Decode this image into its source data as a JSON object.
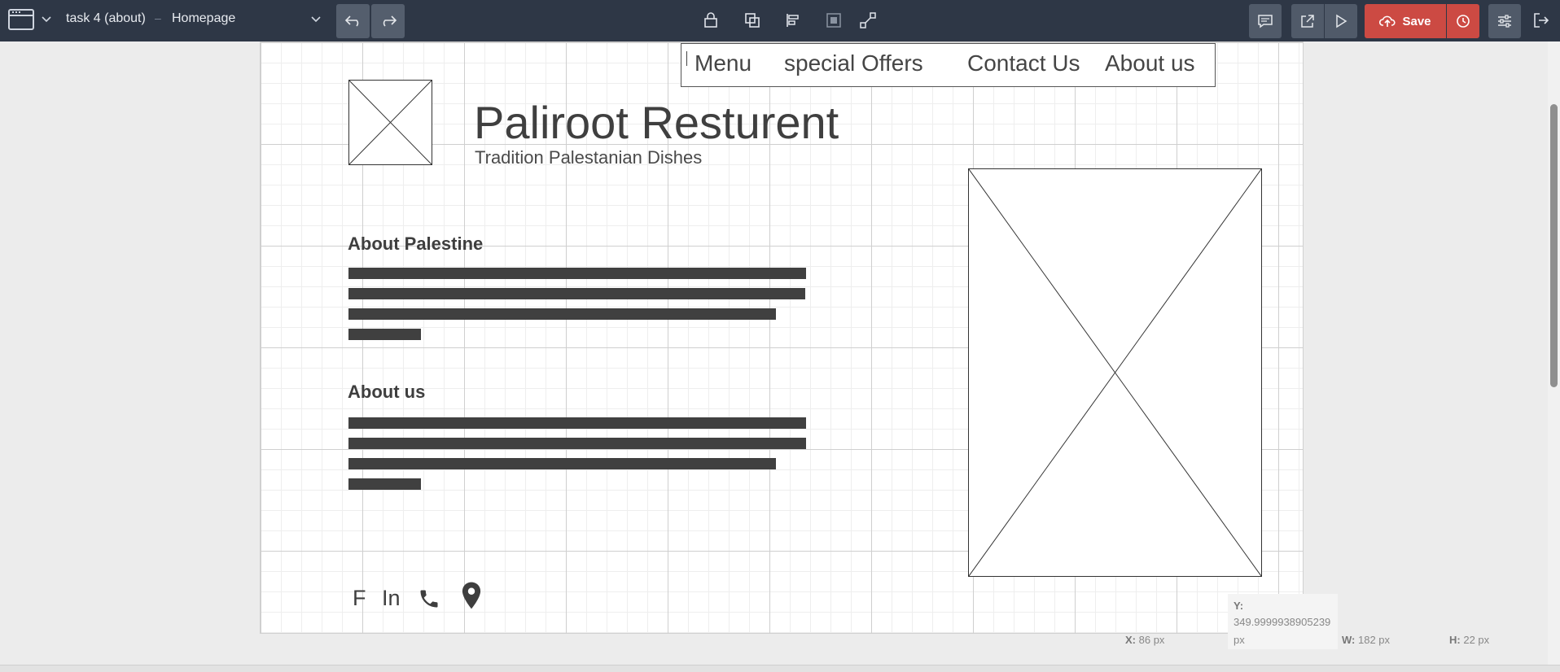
{
  "toolbar": {
    "project_title": "task 4 (about)",
    "separator": "–",
    "page_name": "Homepage",
    "save_label": "Save",
    "icons": [
      "window-icon",
      "chevron-down-icon",
      "undo-icon",
      "redo-icon",
      "lock-icon",
      "duplicate-icon",
      "align-icon",
      "layer-icon",
      "link-icon",
      "comment-icon",
      "external-link-icon",
      "play-icon",
      "cloud-upload-icon",
      "history-icon",
      "settings-sliders-icon",
      "exit-icon"
    ],
    "accent_color": "#cc4a43",
    "bar_color": "#2e3746"
  },
  "wireframe": {
    "nav": [
      "Menu",
      "special Offers",
      "Contact Us",
      "About us"
    ],
    "title": "Paliroot Resturent",
    "subtitle": "Tradition Palestanian Dishes",
    "sections": [
      {
        "heading": "About Palestine"
      },
      {
        "heading": "About us"
      }
    ],
    "social": [
      "F",
      "In"
    ]
  },
  "readouts": {
    "y_label": "Y:",
    "y_value": "349.9999938905239",
    "y_unit": "px",
    "x": {
      "label": "X:",
      "value": "86 px"
    },
    "w": {
      "label": "W:",
      "value": "182 px"
    },
    "h": {
      "label": "H:",
      "value": "22 px"
    }
  }
}
